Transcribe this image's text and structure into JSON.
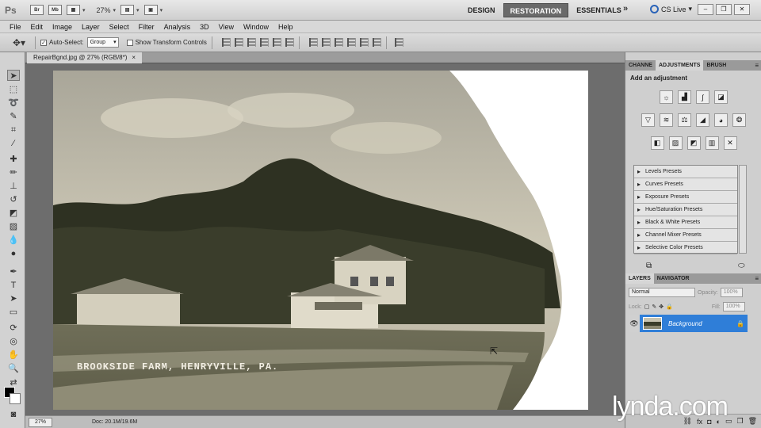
{
  "appbar": {
    "logo": "Ps",
    "br_label": "Br",
    "mb_label": "Mb",
    "zoom": "27%",
    "workspaces": [
      "DESIGN",
      "RESTORATION",
      "ESSENTIALS"
    ],
    "active_workspace": "RESTORATION",
    "more": "»",
    "cs_live": "CS Live"
  },
  "menu": [
    "File",
    "Edit",
    "Image",
    "Layer",
    "Select",
    "Filter",
    "Analysis",
    "3D",
    "View",
    "Window",
    "Help"
  ],
  "options": {
    "auto_select_label": "Auto-Select:",
    "auto_select_value": "Group",
    "transform_label": "Show Transform Controls"
  },
  "document": {
    "tab_title": "RepairBgnd.jpg @ 27% (RGB/8*)",
    "tab_close": "×",
    "caption": "BROOKSIDE FARM, HENRYVILLE, PA.",
    "status_zoom": "27%",
    "status_doc": "Doc: 20.1M/19.6M"
  },
  "adjustments_panel": {
    "tabs": [
      "CHANNE",
      "ADJUSTMENTS",
      "BRUSH"
    ],
    "active_tab": "ADJUSTMENTS",
    "title": "Add an adjustment",
    "presets": [
      "Levels Presets",
      "Curves Presets",
      "Exposure Presets",
      "Hue/Saturation Presets",
      "Black & White Presets",
      "Channel Mixer Presets",
      "Selective Color Presets"
    ]
  },
  "layers_panel": {
    "tabs": [
      "LAYERS",
      "NAVIGATOR"
    ],
    "active_tab": "LAYERS",
    "blend_mode": "Normal",
    "opacity_label": "Opacity:",
    "opacity_value": "100%",
    "lock_label": "Lock:",
    "fill_label": "Fill:",
    "fill_value": "100%",
    "layer_name": "Background"
  },
  "watermark": "lynda.com",
  "colors": {
    "accent": "#2f7ed8",
    "active_workspace_bg": "#6a6a6a",
    "canvas_bg": "#6d6d6d"
  }
}
